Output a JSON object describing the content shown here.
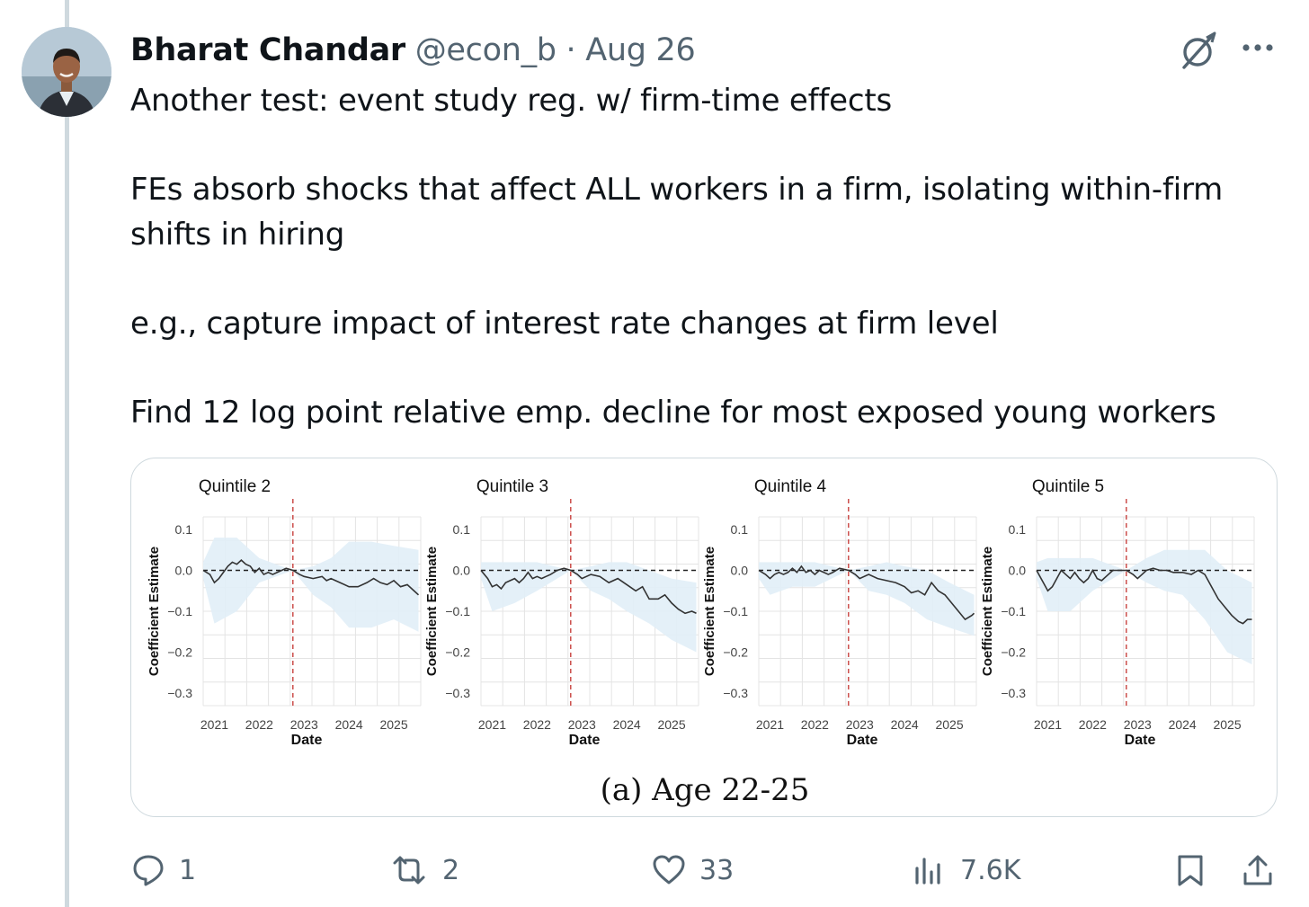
{
  "tweet": {
    "author_name": "Bharat Chandar",
    "handle": "@econ_b",
    "separator": "·",
    "date": "Aug 26",
    "text": "Another test: event study reg. w/ firm-time effects\n\nFEs absorb shocks that affect ALL workers in a firm, isolating within-firm shifts in hiring\n\ne.g., capture impact of interest rate changes at firm level\n\nFind 12 log point relative emp. decline for most exposed young workers"
  },
  "icons": {
    "grok": "grok-icon",
    "more": "more-icon",
    "reply": "reply-icon",
    "repost": "repost-icon",
    "like": "heart-icon",
    "views": "views-icon",
    "bookmark": "bookmark-icon",
    "share": "share-icon"
  },
  "actions": {
    "replies": "1",
    "reposts": "2",
    "likes": "33",
    "views": "7.6K"
  },
  "chart_data": {
    "type": "line",
    "caption": "(a) Age 22-25",
    "xlabel": "Date",
    "ylabel": "Coefficient Estimate",
    "y_ticks": [
      "0.1",
      "0.0",
      "−0.1",
      "−0.2",
      "−0.3"
    ],
    "x_ticks": [
      "2021",
      "2022",
      "2023",
      "2024",
      "2025"
    ],
    "ylim": [
      -0.3,
      0.1
    ],
    "xlim": [
      2020.75,
      2025.6
    ],
    "event_line_x": 2022.75,
    "reference_line_y": 0.0,
    "colors": {
      "line": "#333333",
      "band": "#e1eef7",
      "event": "#c8423f",
      "grid": "#e4e4e4"
    },
    "panels": [
      {
        "title": "Quintile 2",
        "points": [
          [
            2020.75,
            0.0
          ],
          [
            2020.9,
            -0.01
          ],
          [
            2021.0,
            -0.03
          ],
          [
            2021.1,
            -0.02
          ],
          [
            2021.2,
            -0.005
          ],
          [
            2021.3,
            0.01
          ],
          [
            2021.4,
            0.02
          ],
          [
            2021.5,
            0.015
          ],
          [
            2021.6,
            0.025
          ],
          [
            2021.7,
            0.015
          ],
          [
            2021.8,
            0.01
          ],
          [
            2021.9,
            -0.005
          ],
          [
            2022.0,
            0.005
          ],
          [
            2022.1,
            -0.01
          ],
          [
            2022.2,
            -0.005
          ],
          [
            2022.3,
            -0.01
          ],
          [
            2022.4,
            -0.005
          ],
          [
            2022.5,
            0.0
          ],
          [
            2022.6,
            0.005
          ],
          [
            2022.75,
            0.0
          ],
          [
            2022.9,
            -0.01
          ],
          [
            2023.0,
            -0.015
          ],
          [
            2023.2,
            -0.02
          ],
          [
            2023.4,
            -0.015
          ],
          [
            2023.5,
            -0.025
          ],
          [
            2023.6,
            -0.02
          ],
          [
            2023.8,
            -0.03
          ],
          [
            2024.0,
            -0.04
          ],
          [
            2024.2,
            -0.04
          ],
          [
            2024.4,
            -0.03
          ],
          [
            2024.55,
            -0.02
          ],
          [
            2024.7,
            -0.03
          ],
          [
            2024.85,
            -0.035
          ],
          [
            2025.0,
            -0.025
          ],
          [
            2025.15,
            -0.04
          ],
          [
            2025.3,
            -0.035
          ],
          [
            2025.45,
            -0.05
          ],
          [
            2025.55,
            -0.06
          ]
        ],
        "band": [
          [
            2020.75,
            0.02,
            -0.02
          ],
          [
            2021.0,
            0.08,
            -0.13
          ],
          [
            2021.5,
            0.08,
            -0.1
          ],
          [
            2022.0,
            0.03,
            -0.03
          ],
          [
            2022.75,
            0.0,
            0.0
          ],
          [
            2023.2,
            0.01,
            -0.06
          ],
          [
            2023.6,
            0.03,
            -0.09
          ],
          [
            2024.0,
            0.07,
            -0.14
          ],
          [
            2024.5,
            0.07,
            -0.14
          ],
          [
            2025.0,
            0.06,
            -0.12
          ],
          [
            2025.55,
            0.05,
            -0.15
          ]
        ]
      },
      {
        "title": "Quintile 3",
        "points": [
          [
            2020.75,
            0.0
          ],
          [
            2020.9,
            -0.02
          ],
          [
            2021.0,
            -0.04
          ],
          [
            2021.1,
            -0.035
          ],
          [
            2021.2,
            -0.045
          ],
          [
            2021.3,
            -0.03
          ],
          [
            2021.4,
            -0.025
          ],
          [
            2021.5,
            -0.02
          ],
          [
            2021.6,
            -0.03
          ],
          [
            2021.7,
            -0.02
          ],
          [
            2021.8,
            -0.005
          ],
          [
            2021.9,
            -0.02
          ],
          [
            2022.0,
            -0.015
          ],
          [
            2022.1,
            -0.02
          ],
          [
            2022.2,
            -0.015
          ],
          [
            2022.3,
            -0.01
          ],
          [
            2022.45,
            0.0
          ],
          [
            2022.6,
            0.005
          ],
          [
            2022.75,
            0.0
          ],
          [
            2022.9,
            -0.01
          ],
          [
            2023.0,
            -0.02
          ],
          [
            2023.2,
            -0.01
          ],
          [
            2023.4,
            -0.015
          ],
          [
            2023.6,
            -0.03
          ],
          [
            2023.8,
            -0.02
          ],
          [
            2024.0,
            -0.035
          ],
          [
            2024.2,
            -0.05
          ],
          [
            2024.35,
            -0.04
          ],
          [
            2024.5,
            -0.07
          ],
          [
            2024.7,
            -0.07
          ],
          [
            2024.85,
            -0.06
          ],
          [
            2025.0,
            -0.08
          ],
          [
            2025.15,
            -0.095
          ],
          [
            2025.3,
            -0.105
          ],
          [
            2025.45,
            -0.1
          ],
          [
            2025.55,
            -0.105
          ]
        ],
        "band": [
          [
            2020.75,
            0.02,
            -0.02
          ],
          [
            2021.0,
            0.02,
            -0.1
          ],
          [
            2021.5,
            0.02,
            -0.08
          ],
          [
            2022.0,
            0.02,
            -0.05
          ],
          [
            2022.75,
            0.0,
            0.0
          ],
          [
            2023.2,
            0.01,
            -0.05
          ],
          [
            2023.6,
            0.02,
            -0.07
          ],
          [
            2024.0,
            0.02,
            -0.1
          ],
          [
            2024.5,
            0.0,
            -0.13
          ],
          [
            2025.0,
            -0.02,
            -0.17
          ],
          [
            2025.55,
            -0.03,
            -0.2
          ]
        ]
      },
      {
        "title": "Quintile 4",
        "points": [
          [
            2020.75,
            0.0
          ],
          [
            2020.9,
            -0.01
          ],
          [
            2021.0,
            -0.02
          ],
          [
            2021.1,
            -0.01
          ],
          [
            2021.2,
            -0.005
          ],
          [
            2021.3,
            -0.01
          ],
          [
            2021.4,
            -0.005
          ],
          [
            2021.5,
            0.005
          ],
          [
            2021.6,
            -0.005
          ],
          [
            2021.7,
            0.01
          ],
          [
            2021.8,
            -0.005
          ],
          [
            2021.9,
            0.0
          ],
          [
            2022.0,
            -0.01
          ],
          [
            2022.1,
            0.0
          ],
          [
            2022.2,
            -0.005
          ],
          [
            2022.3,
            -0.01
          ],
          [
            2022.4,
            -0.005
          ],
          [
            2022.55,
            0.005
          ],
          [
            2022.75,
            0.0
          ],
          [
            2022.9,
            -0.01
          ],
          [
            2023.0,
            -0.02
          ],
          [
            2023.2,
            -0.01
          ],
          [
            2023.4,
            -0.02
          ],
          [
            2023.6,
            -0.025
          ],
          [
            2023.8,
            -0.03
          ],
          [
            2024.0,
            -0.04
          ],
          [
            2024.15,
            -0.055
          ],
          [
            2024.3,
            -0.05
          ],
          [
            2024.45,
            -0.06
          ],
          [
            2024.6,
            -0.03
          ],
          [
            2024.75,
            -0.05
          ],
          [
            2024.9,
            -0.06
          ],
          [
            2025.05,
            -0.08
          ],
          [
            2025.2,
            -0.1
          ],
          [
            2025.35,
            -0.12
          ],
          [
            2025.5,
            -0.11
          ],
          [
            2025.55,
            -0.105
          ]
        ],
        "band": [
          [
            2020.75,
            0.02,
            -0.02
          ],
          [
            2021.0,
            0.02,
            -0.06
          ],
          [
            2021.5,
            0.02,
            -0.04
          ],
          [
            2022.0,
            0.02,
            -0.04
          ],
          [
            2022.75,
            0.0,
            0.0
          ],
          [
            2023.2,
            0.01,
            -0.05
          ],
          [
            2023.6,
            0.02,
            -0.06
          ],
          [
            2024.0,
            0.01,
            -0.08
          ],
          [
            2024.5,
            0.0,
            -0.12
          ],
          [
            2025.0,
            -0.03,
            -0.14
          ],
          [
            2025.55,
            -0.06,
            -0.16
          ]
        ]
      },
      {
        "title": "Quintile 5",
        "points": [
          [
            2020.75,
            0.0
          ],
          [
            2020.9,
            -0.03
          ],
          [
            2021.0,
            -0.05
          ],
          [
            2021.1,
            -0.04
          ],
          [
            2021.2,
            -0.02
          ],
          [
            2021.3,
            0.0
          ],
          [
            2021.4,
            -0.01
          ],
          [
            2021.5,
            -0.02
          ],
          [
            2021.6,
            -0.005
          ],
          [
            2021.7,
            -0.02
          ],
          [
            2021.8,
            -0.03
          ],
          [
            2021.9,
            -0.02
          ],
          [
            2022.0,
            0.0
          ],
          [
            2022.1,
            -0.02
          ],
          [
            2022.2,
            -0.025
          ],
          [
            2022.3,
            -0.015
          ],
          [
            2022.45,
            0.0
          ],
          [
            2022.6,
            0.0
          ],
          [
            2022.75,
            0.0
          ],
          [
            2022.9,
            -0.01
          ],
          [
            2023.0,
            -0.02
          ],
          [
            2023.1,
            -0.01
          ],
          [
            2023.2,
            0.0
          ],
          [
            2023.35,
            0.005
          ],
          [
            2023.5,
            0.0
          ],
          [
            2023.65,
            0.0
          ],
          [
            2023.8,
            -0.005
          ],
          [
            2024.0,
            -0.005
          ],
          [
            2024.2,
            -0.01
          ],
          [
            2024.35,
            0.0
          ],
          [
            2024.5,
            -0.01
          ],
          [
            2024.65,
            -0.04
          ],
          [
            2024.8,
            -0.07
          ],
          [
            2024.95,
            -0.09
          ],
          [
            2025.1,
            -0.11
          ],
          [
            2025.25,
            -0.125
          ],
          [
            2025.35,
            -0.13
          ],
          [
            2025.45,
            -0.12
          ],
          [
            2025.55,
            -0.12
          ]
        ],
        "band": [
          [
            2020.75,
            0.02,
            -0.02
          ],
          [
            2021.0,
            0.03,
            -0.1
          ],
          [
            2021.5,
            0.03,
            -0.1
          ],
          [
            2022.0,
            0.03,
            -0.05
          ],
          [
            2022.75,
            0.0,
            0.0
          ],
          [
            2023.2,
            0.03,
            -0.03
          ],
          [
            2023.6,
            0.05,
            -0.05
          ],
          [
            2024.0,
            0.05,
            -0.06
          ],
          [
            2024.5,
            0.05,
            -0.12
          ],
          [
            2025.0,
            0.0,
            -0.2
          ],
          [
            2025.55,
            -0.03,
            -0.23
          ]
        ]
      }
    ]
  }
}
